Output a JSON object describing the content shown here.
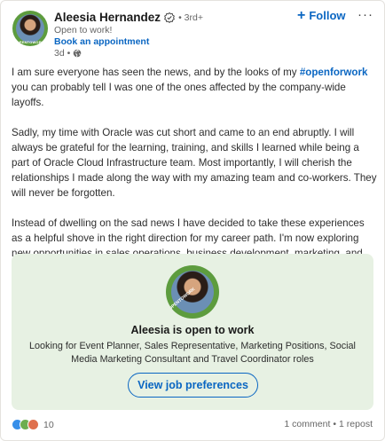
{
  "author": {
    "name": "Aleesia Hernandez",
    "degree": "• 3rd+",
    "headline": "Open to work!",
    "book_label": "Book an appointment",
    "time": "3d •",
    "avatar_badge": "#OPENTOWORK"
  },
  "actions": {
    "follow_label": "Follow",
    "more_label": "···"
  },
  "post": {
    "p1_before": "I am sure everyone has seen the news, and by the looks of my ",
    "p1_hashtag": "#openforwork",
    "p1_after": " you can probably tell I was one of the ones affected by the company-wide layoffs.",
    "p2": "Sadly, my time with Oracle was cut short and came to an end abruptly. I will always be grateful for the learning, training, and skills I learned while being a part of Oracle Cloud Infrastructure team. Most importantly, I will cherish the relationships I made along the way with my amazing team and co-workers. They will never be forgotten.",
    "p3": "Instead of dwelling on the sad news I have decided to take these experiences as a helpful shove in the right direction for my career path. I'm now exploring new opportunities in sales operations, business development, marketing, and event planning. Open to connect, collaborate, and learn about what's next."
  },
  "open_to_work": {
    "title": "Aleesia is open to work",
    "description": "Looking for Event Planner, Sales Representative, Marketing Positions, Social Media Marketing Consultant and Travel Coordinator roles",
    "button_label": "View job preferences",
    "avatar_badge": "#OPENTOWORK"
  },
  "footer": {
    "reaction_count": "10",
    "comments": "1 comment",
    "separator": "•",
    "reposts": "1 repost"
  },
  "colors": {
    "accent": "#0a66c2",
    "otw_bg": "#e7f1e3",
    "otw_ring": "#5d9c3e"
  }
}
